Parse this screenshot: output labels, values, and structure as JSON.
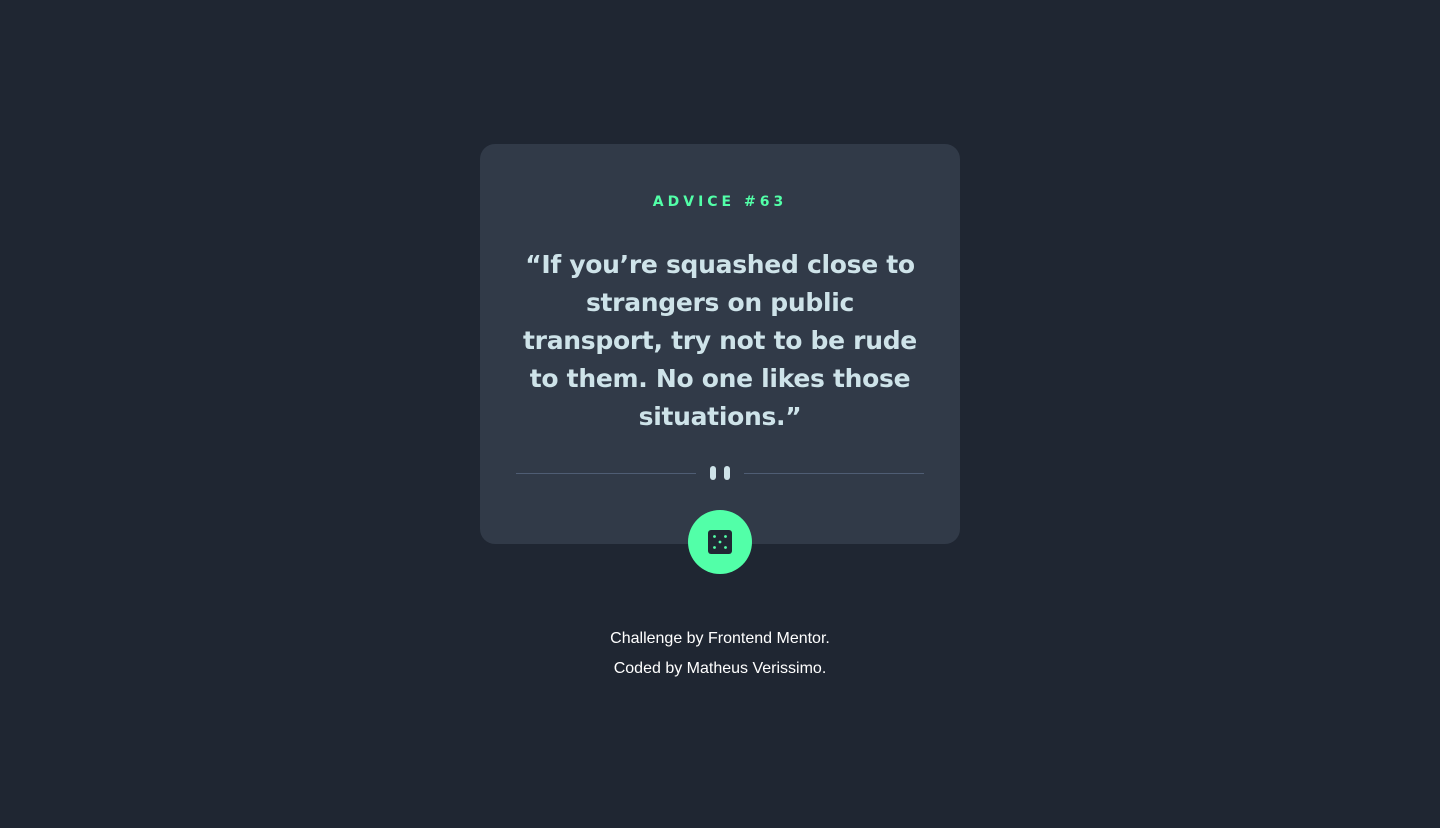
{
  "card": {
    "advice_label": "ADVICE #63",
    "quote": "“If you’re squashed close to strangers on public transport, try not to be rude to them. No one likes those situations.”"
  },
  "icons": {
    "divider": "pause-divider-icon",
    "dice": "dice-icon"
  },
  "footer": {
    "line1": "Challenge by Frontend Mentor.",
    "line2": "Coded by Matheus Verissimo."
  },
  "colors": {
    "background": "#1f2632",
    "card": "#313a48",
    "accent": "#52ffa8",
    "quote_text": "#cee3e9",
    "divider": "#4f5d74"
  }
}
